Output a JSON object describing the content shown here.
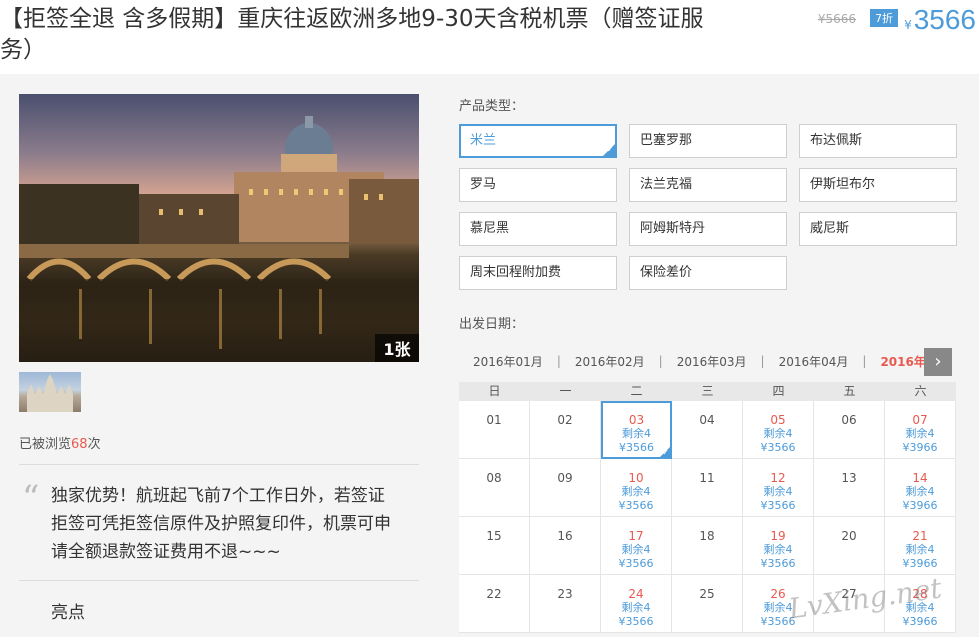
{
  "header": {
    "title": "【拒签全退 含多假期】重庆往返欧洲多地9-30天含税机票（赠签证服务）",
    "original_price": "¥5666",
    "discount": "7折",
    "price_symbol": "¥",
    "price": "3566"
  },
  "gallery": {
    "photo_count": "1张",
    "views_prefix": "已被浏览",
    "views_count": "68",
    "views_suffix": "次"
  },
  "description": {
    "quote_mark": "“",
    "text": "独家优势！航班起飞前7个工作日外，若签证拒签可凭拒签信原件及护照复印件，机票可申请全额退款签证费用不退~~~",
    "highlights_label": "亮点"
  },
  "product": {
    "label": "产品类型：",
    "options": [
      "米兰",
      "巴塞罗那",
      "布达佩斯",
      "罗马",
      "法兰克福",
      "伊斯坦布尔",
      "慕尼黑",
      "阿姆斯特丹",
      "威尼斯",
      "周末回程附加费",
      "保险差价"
    ],
    "selected": "米兰"
  },
  "dates": {
    "label": "出发日期：",
    "months": [
      "2016年01月",
      "2016年02月",
      "2016年03月",
      "2016年04月",
      "2016年"
    ],
    "active_month": "2016年",
    "next_icon": "chevron-right-icon",
    "weekdays": [
      "日",
      "一",
      "二",
      "三",
      "四",
      "五",
      "六"
    ],
    "rows": [
      [
        {
          "d": "01"
        },
        {
          "d": "02"
        },
        {
          "d": "03",
          "left": "剩余4",
          "price": "¥3566",
          "selected": true
        },
        {
          "d": "04"
        },
        {
          "d": "05",
          "left": "剩余4",
          "price": "¥3566"
        },
        {
          "d": "06"
        },
        {
          "d": "07",
          "left": "剩余4",
          "price": "¥3966"
        }
      ],
      [
        {
          "d": "08"
        },
        {
          "d": "09"
        },
        {
          "d": "10",
          "left": "剩余4",
          "price": "¥3566"
        },
        {
          "d": "11"
        },
        {
          "d": "12",
          "left": "剩余4",
          "price": "¥3566"
        },
        {
          "d": "13"
        },
        {
          "d": "14",
          "left": "剩余4",
          "price": "¥3966"
        }
      ],
      [
        {
          "d": "15"
        },
        {
          "d": "16"
        },
        {
          "d": "17",
          "left": "剩余4",
          "price": "¥3566"
        },
        {
          "d": "18"
        },
        {
          "d": "19",
          "left": "剩余4",
          "price": "¥3566"
        },
        {
          "d": "20"
        },
        {
          "d": "21",
          "left": "剩余4",
          "price": "¥3966"
        }
      ],
      [
        {
          "d": "22"
        },
        {
          "d": "23"
        },
        {
          "d": "24",
          "left": "剩余4",
          "price": "¥3566"
        },
        {
          "d": "25"
        },
        {
          "d": "26",
          "left": "剩余4",
          "price": "¥3566"
        },
        {
          "d": "27"
        },
        {
          "d": "28",
          "left": "剩余4",
          "price": "¥3966"
        }
      ]
    ]
  },
  "watermark": "LvXing.net",
  "colors": {
    "accent": "#4d9bd9",
    "red": "#e85a4f"
  }
}
